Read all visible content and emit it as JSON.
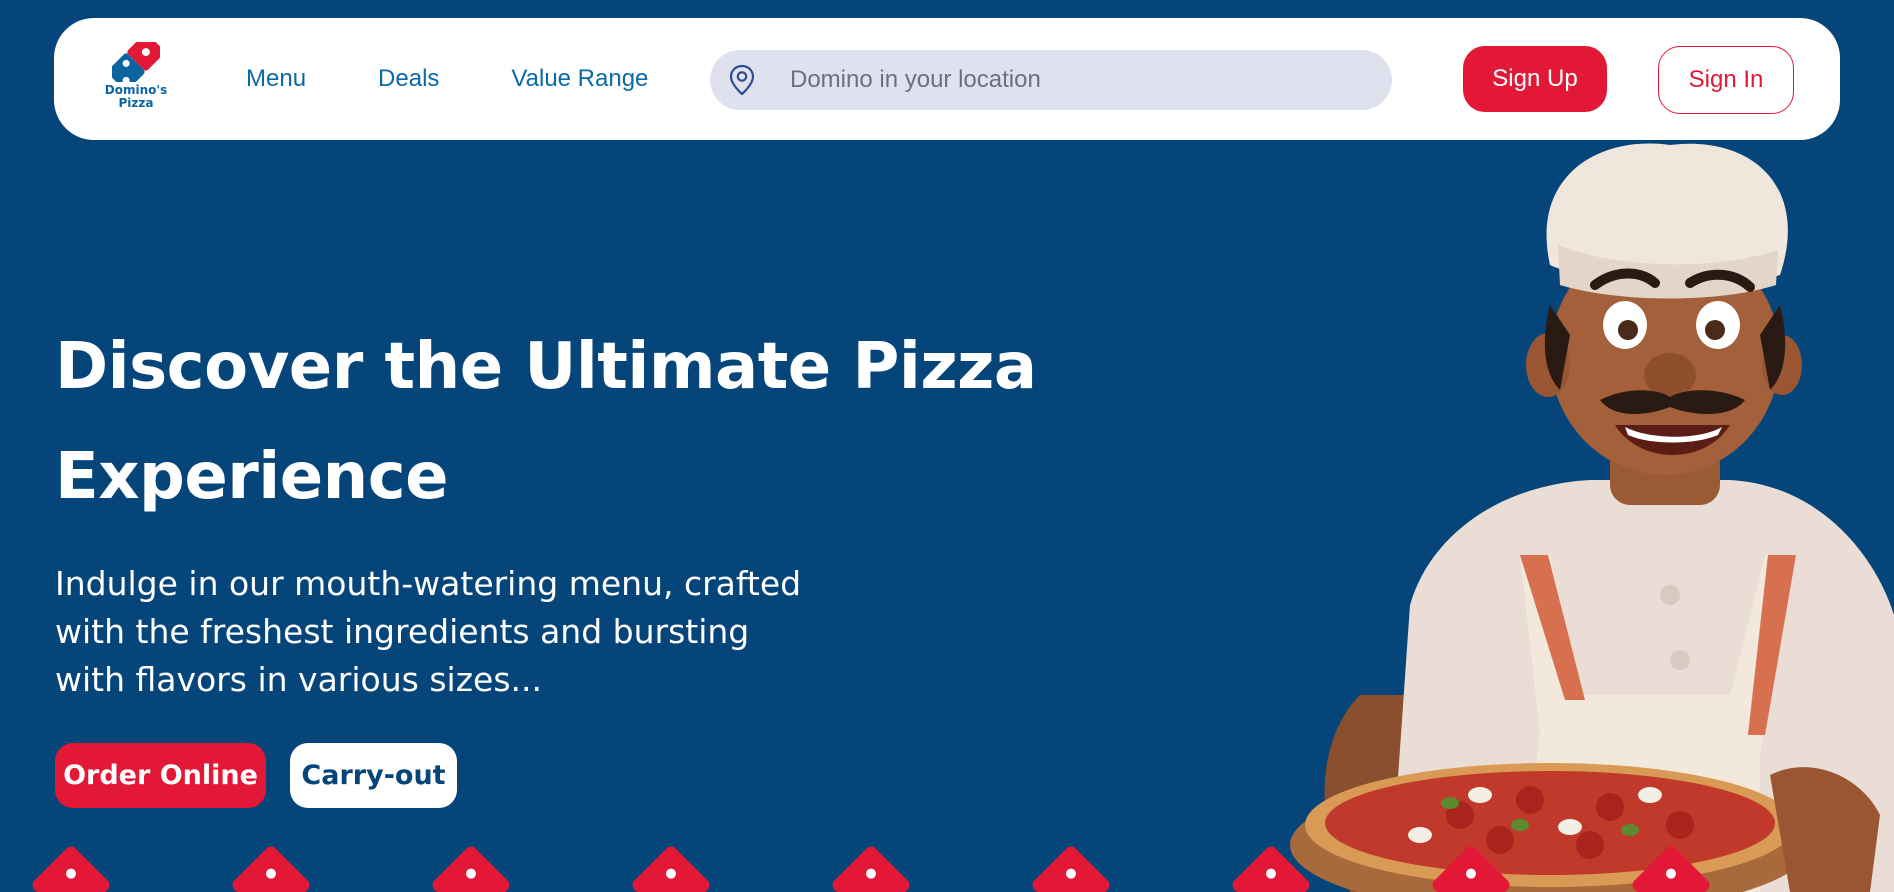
{
  "header": {
    "logo_line1": "Domino's",
    "logo_line2": "Pizza",
    "nav": [
      {
        "label": "Menu"
      },
      {
        "label": "Deals"
      },
      {
        "label": "Value Range"
      }
    ],
    "search": {
      "placeholder": "Domino in your location",
      "icon": "location-pin-icon"
    },
    "signup_label": "Sign Up",
    "signin_label": "Sign In"
  },
  "hero": {
    "title": "Discover the Ultimate Pizza Experience",
    "description": "Indulge in our mouth-watering menu, crafted with the freshest ingredients and bursting with flavors in various sizes...",
    "primary_button": "Order Online",
    "secondary_button": "Carry-out"
  },
  "colors": {
    "background": "#06457a",
    "accent_red": "#e31837",
    "nav_link_blue": "#0b6aa6",
    "search_bg": "#dfe2ee"
  }
}
